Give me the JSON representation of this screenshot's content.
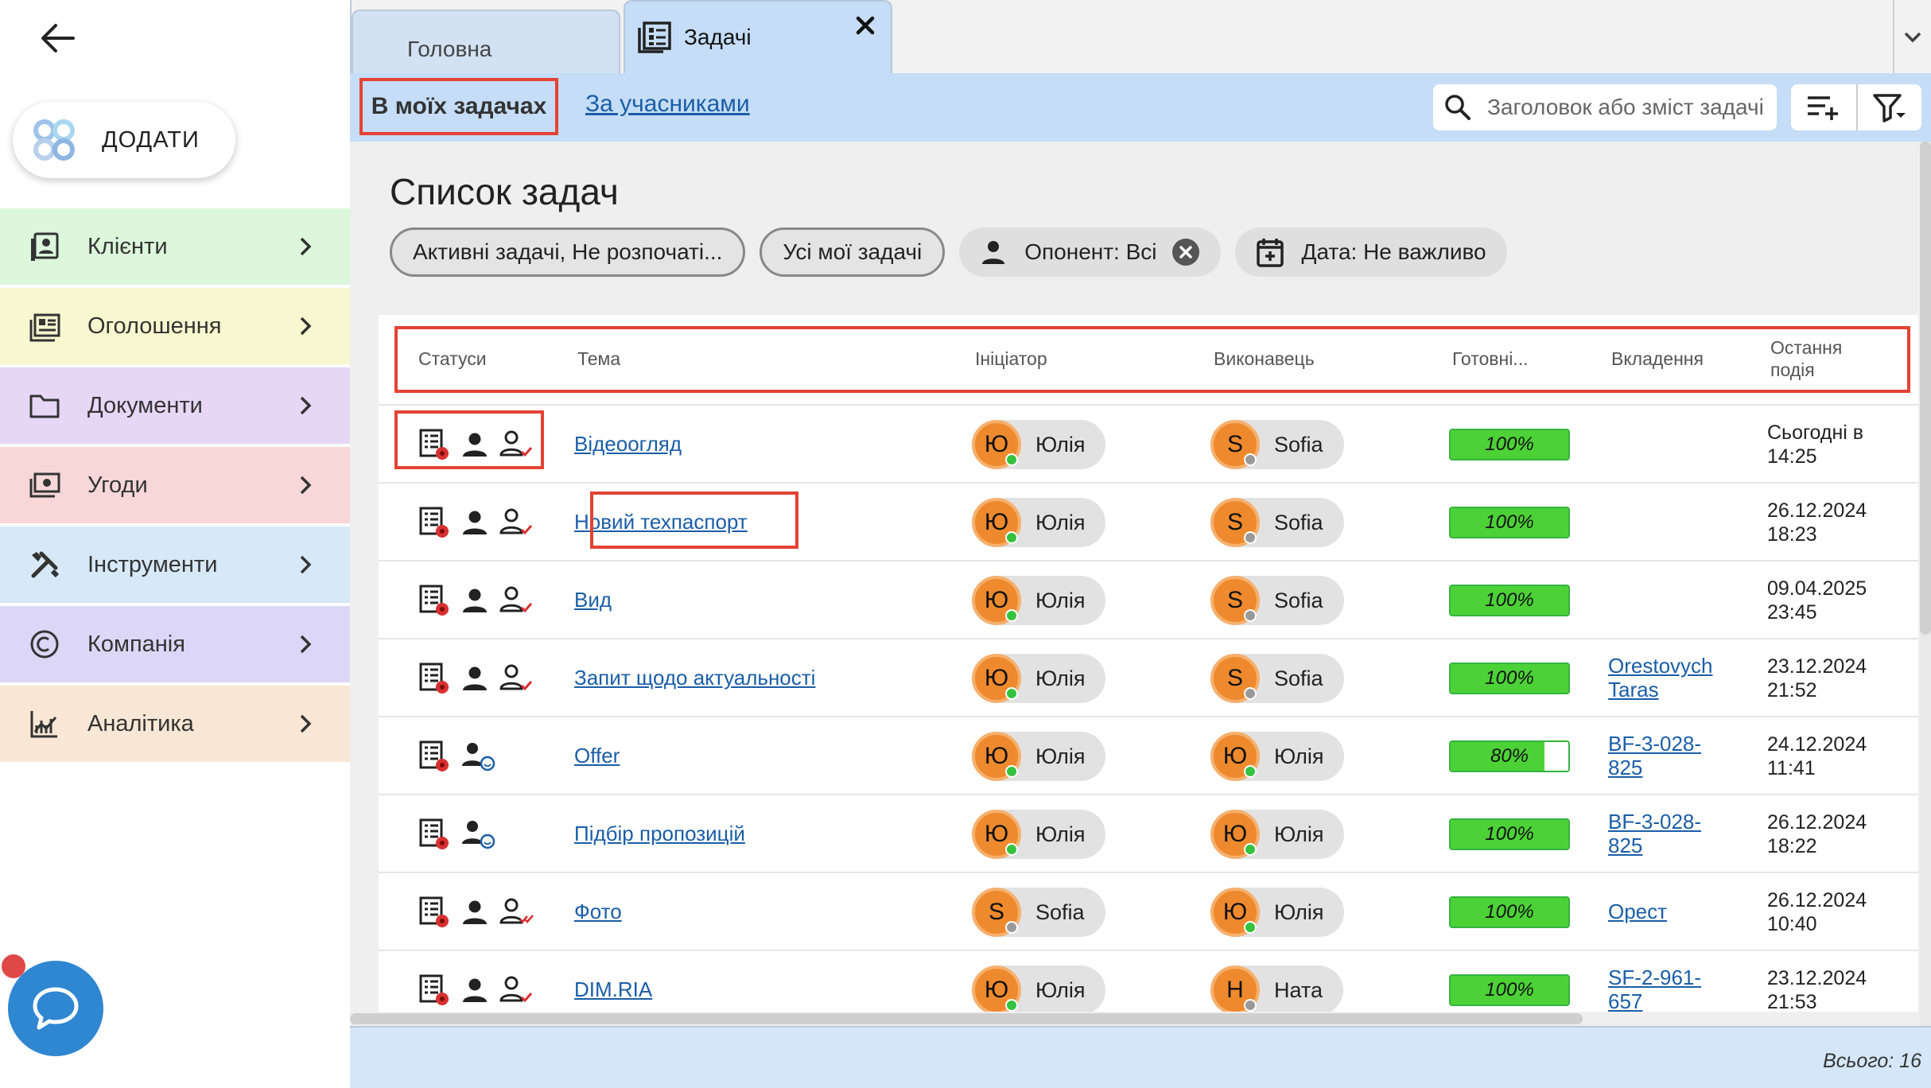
{
  "sidebar": {
    "add_label": "ДОДАТИ",
    "items": [
      {
        "label": "Клієнти",
        "icon": "contacts-icon",
        "color": "#dcf7dc"
      },
      {
        "label": "Оголошення",
        "icon": "listing-icon",
        "color": "#f8f8d0"
      },
      {
        "label": "Документи",
        "icon": "folder-icon",
        "color": "#e6d7f7"
      },
      {
        "label": "Угоди",
        "icon": "money-icon",
        "color": "#f7d7d7"
      },
      {
        "label": "Інструменти",
        "icon": "tools-icon",
        "color": "#d7e8f7"
      },
      {
        "label": "Компанія",
        "icon": "copyright-icon",
        "color": "#dcd7f7"
      },
      {
        "label": "Аналітика",
        "icon": "analytics-icon",
        "color": "#f8e7d4"
      }
    ]
  },
  "tabs": {
    "home": "Головна",
    "tasks": "Задачі"
  },
  "subtabs": {
    "mine": "В моїх задачах",
    "participants": "За учасниками"
  },
  "search": {
    "placeholder": "Заголовок або зміст задачі"
  },
  "page": {
    "title": "Список задач"
  },
  "filters": {
    "status": "Активні задачі, Не розпочаті...",
    "scope": "Усі мої задачі",
    "opponent": "Опонент: Всі",
    "date": "Дата: Не важливо"
  },
  "table": {
    "headers": {
      "statuses": "Статуси",
      "topic": "Тема",
      "initiator": "Ініціатор",
      "executor": "Виконавець",
      "readiness": "Готовні...",
      "attachments": "Вкладення",
      "last_event": "Остання\nподія"
    },
    "rows": [
      {
        "topic": "Відеоогляд",
        "status_set": "assigned-done",
        "initiator": {
          "initial": "Ю",
          "name": "Юлія",
          "online": true
        },
        "executor": {
          "initial": "S",
          "name": "Sofia",
          "online": false
        },
        "progress": 100,
        "progress_label": "100%",
        "attachment": "",
        "last_event": "Сьогодні в\n14:25"
      },
      {
        "topic": "Новий техпаспорт",
        "status_set": "assigned-done",
        "initiator": {
          "initial": "Ю",
          "name": "Юлія",
          "online": true
        },
        "executor": {
          "initial": "S",
          "name": "Sofia",
          "online": false
        },
        "progress": 100,
        "progress_label": "100%",
        "attachment": "",
        "last_event": "26.12.2024\n18:23"
      },
      {
        "topic": "Вид",
        "status_set": "assigned-done",
        "initiator": {
          "initial": "Ю",
          "name": "Юлія",
          "online": true
        },
        "executor": {
          "initial": "S",
          "name": "Sofia",
          "online": false
        },
        "progress": 100,
        "progress_label": "100%",
        "attachment": "",
        "last_event": "09.04.2025\n23:45"
      },
      {
        "topic": "Запит щодо актуальності",
        "status_set": "assigned-done",
        "initiator": {
          "initial": "Ю",
          "name": "Юлія",
          "online": true
        },
        "executor": {
          "initial": "S",
          "name": "Sofia",
          "online": false
        },
        "progress": 100,
        "progress_label": "100%",
        "attachment": "Orestovych\nTaras",
        "last_event": "23.12.2024\n21:52"
      },
      {
        "topic": "Offer",
        "status_set": "self",
        "initiator": {
          "initial": "Ю",
          "name": "Юлія",
          "online": true
        },
        "executor": {
          "initial": "Ю",
          "name": "Юлія",
          "online": true
        },
        "progress": 80,
        "progress_label": "80%",
        "attachment": "BF-3-028-\n825",
        "last_event": "24.12.2024\n11:41"
      },
      {
        "topic": "Підбір пропозицій",
        "status_set": "self",
        "initiator": {
          "initial": "Ю",
          "name": "Юлія",
          "online": true
        },
        "executor": {
          "initial": "Ю",
          "name": "Юлія",
          "online": true
        },
        "progress": 100,
        "progress_label": "100%",
        "attachment": "BF-3-028-\n825",
        "last_event": "26.12.2024\n18:22"
      },
      {
        "topic": "Фото",
        "status_set": "assigned-double",
        "initiator": {
          "initial": "S",
          "name": "Sofia",
          "online": false
        },
        "executor": {
          "initial": "Ю",
          "name": "Юлія",
          "online": true
        },
        "progress": 100,
        "progress_label": "100%",
        "attachment": "Орест",
        "last_event": "26.12.2024\n10:40"
      },
      {
        "topic": "DIM.RIA",
        "status_set": "assigned-done",
        "initiator": {
          "initial": "Ю",
          "name": "Юлія",
          "online": true
        },
        "executor": {
          "initial": "Н",
          "name": "Ната",
          "online": false
        },
        "progress": 100,
        "progress_label": "100%",
        "attachment": "SF-2-961-\n657",
        "last_event": "23.12.2024\n21:53"
      }
    ]
  },
  "footer": {
    "total": "Всього: 16"
  },
  "colors": {
    "accent_blue": "#c5ddf7",
    "highlight_red": "#e34234",
    "progress_green": "#4cd137",
    "avatar_orange": "#ee8a2d",
    "link": "#1a5ea8"
  }
}
